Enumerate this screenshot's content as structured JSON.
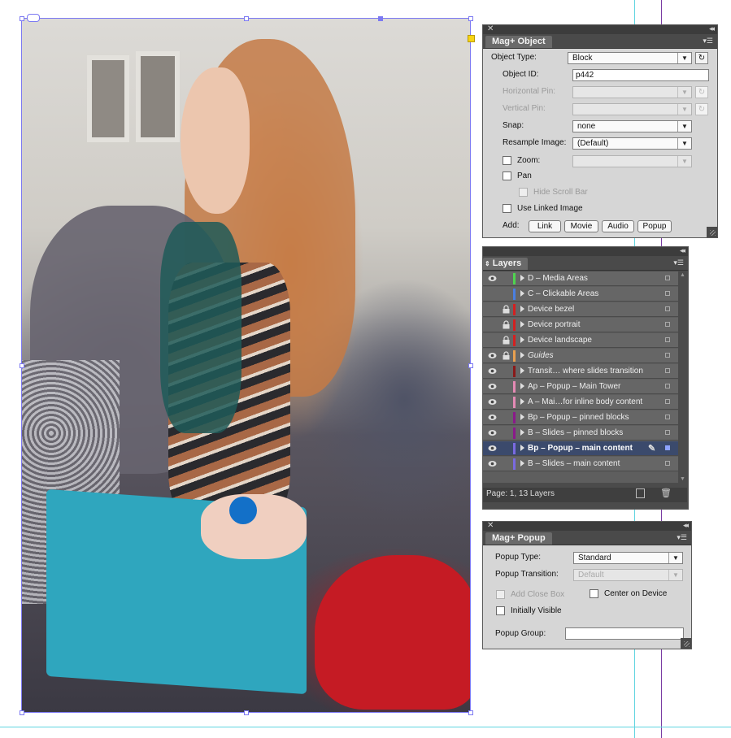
{
  "colors": {
    "guide_cyan": "#5fd4e0",
    "guide_purple": "#7a3da3",
    "selection": "#7c79f2",
    "anchor_yellow": "#f7d413"
  },
  "object_panel": {
    "close_icon": "close-icon",
    "tab": "Mag+ Object",
    "object_type_label": "Object Type:",
    "object_type_value": "Block",
    "object_id_label": "Object ID:",
    "object_id_value": "p442",
    "horizontal_pin_label": "Horizontal Pin:",
    "horizontal_pin_value": "",
    "vertical_pin_label": "Vertical Pin:",
    "vertical_pin_value": "",
    "snap_label": "Snap:",
    "snap_value": "none",
    "resample_label": "Resample Image:",
    "resample_value": "(Default)",
    "zoom_label": "Zoom:",
    "zoom_value": "",
    "pan_label": "Pan",
    "hide_scroll_label": "Hide Scroll Bar",
    "use_linked_label": "Use Linked Image",
    "add_label": "Add:",
    "buttons": [
      "Link",
      "Movie",
      "Audio",
      "Popup"
    ]
  },
  "layers_panel": {
    "tab": "Layers",
    "footer": "Page: 1, 13 Layers",
    "layers": [
      {
        "name": "D – Media Areas",
        "color": "#4fd44f",
        "visible": true,
        "locked": false,
        "italic": false,
        "selected": false
      },
      {
        "name": "C – Clickable Areas",
        "color": "#4a7fe0",
        "visible": false,
        "locked": false,
        "italic": false,
        "selected": false
      },
      {
        "name": "Device bezel",
        "color": "#d42020",
        "visible": false,
        "locked": true,
        "italic": false,
        "selected": false
      },
      {
        "name": "Device portrait",
        "color": "#d42020",
        "visible": false,
        "locked": true,
        "italic": false,
        "selected": false
      },
      {
        "name": "Device landscape",
        "color": "#d42020",
        "visible": false,
        "locked": true,
        "italic": false,
        "selected": false
      },
      {
        "name": "Guides",
        "color": "#e8a050",
        "visible": true,
        "locked": true,
        "italic": true,
        "selected": false
      },
      {
        "name": "Transit… where slides transition",
        "color": "#8a1a1a",
        "visible": true,
        "locked": false,
        "italic": false,
        "selected": false
      },
      {
        "name": "Ap – Popup – Main Tower",
        "color": "#e48ab4",
        "visible": true,
        "locked": false,
        "italic": false,
        "selected": false
      },
      {
        "name": "A – Mai…for inline body content",
        "color": "#e48ab4",
        "visible": true,
        "locked": false,
        "italic": false,
        "selected": false
      },
      {
        "name": "Bp – Popup – pinned blocks",
        "color": "#8a1a8a",
        "visible": true,
        "locked": false,
        "italic": false,
        "selected": false
      },
      {
        "name": "B – Slides – pinned blocks",
        "color": "#8a1a8a",
        "visible": true,
        "locked": false,
        "italic": false,
        "selected": false
      },
      {
        "name": "Bp – Popup – main content",
        "color": "#7a6ae0",
        "visible": true,
        "locked": false,
        "italic": false,
        "selected": true
      },
      {
        "name": "B – Slides – main content",
        "color": "#7a6ae0",
        "visible": true,
        "locked": false,
        "italic": false,
        "selected": false
      }
    ]
  },
  "popup_panel": {
    "tab": "Mag+ Popup",
    "popup_type_label": "Popup Type:",
    "popup_type_value": "Standard",
    "popup_transition_label": "Popup Transition:",
    "popup_transition_value": "Default",
    "add_close_label": "Add Close Box",
    "center_label": "Center on Device",
    "initially_visible_label": "Initially Visible",
    "popup_group_label": "Popup Group:",
    "popup_group_value": ""
  }
}
